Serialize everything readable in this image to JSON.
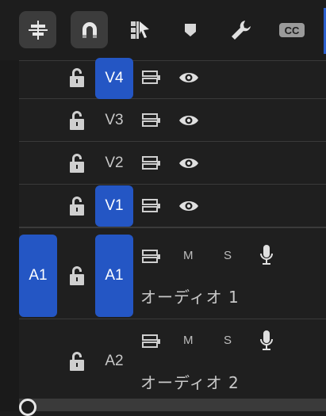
{
  "toolbar": {
    "buttons": [
      {
        "name": "insert-overwrite-icon",
        "active": true
      },
      {
        "name": "snap-magnet-icon",
        "active": true
      },
      {
        "name": "linked-selection-icon",
        "active": false
      },
      {
        "name": "add-marker-icon",
        "active": false
      },
      {
        "name": "wrench-settings-icon",
        "active": false
      },
      {
        "name": "captions-icon",
        "active": false
      }
    ],
    "cc_label": "CC"
  },
  "video_tracks": [
    {
      "label": "V4",
      "targeted": true
    },
    {
      "label": "V3",
      "targeted": false
    },
    {
      "label": "V2",
      "targeted": false
    },
    {
      "label": "V1",
      "targeted": true
    }
  ],
  "audio_tracks": [
    {
      "source": "A1",
      "label": "A1",
      "targeted": true,
      "mute": "M",
      "solo": "S",
      "name": "オーディオ 1"
    },
    {
      "source": "",
      "label": "A2",
      "targeted": false,
      "mute": "M",
      "solo": "S",
      "name": "オーディオ 2"
    }
  ],
  "colors": {
    "accent": "#2456c4",
    "background": "#1d1d1d"
  }
}
